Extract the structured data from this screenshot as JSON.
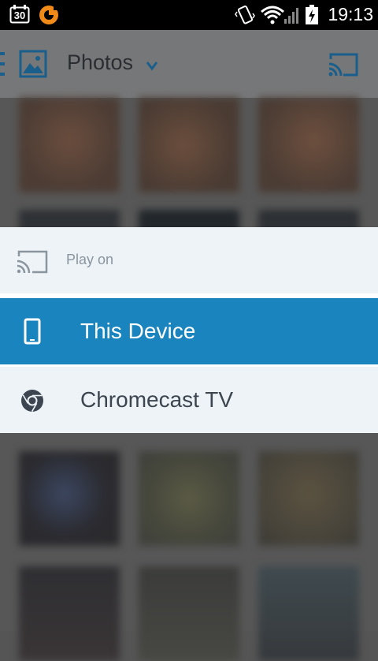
{
  "status_bar": {
    "calendar_date": "30",
    "time": "19:13",
    "icons": [
      "calendar-icon",
      "app-notification-icon",
      "vibrate-icon",
      "wifi-icon",
      "signal-icon",
      "battery-charging-icon"
    ]
  },
  "action_bar": {
    "title": "Photos",
    "icons": [
      "menu-icon",
      "photos-icon",
      "dropdown-icon",
      "cast-icon"
    ]
  },
  "dialog": {
    "header": "Play on",
    "header_icon": "cast-icon",
    "options": [
      {
        "label": "This Device",
        "icon": "phone-icon",
        "selected": true
      },
      {
        "label": "Chromecast TV",
        "icon": "chrome-icon",
        "selected": false
      }
    ]
  },
  "colors": {
    "accent": "#1a84bf",
    "dialog_bg": "#edf3f6",
    "status_bar": "#000000",
    "action_icon_blue": "#1a5f8c"
  }
}
